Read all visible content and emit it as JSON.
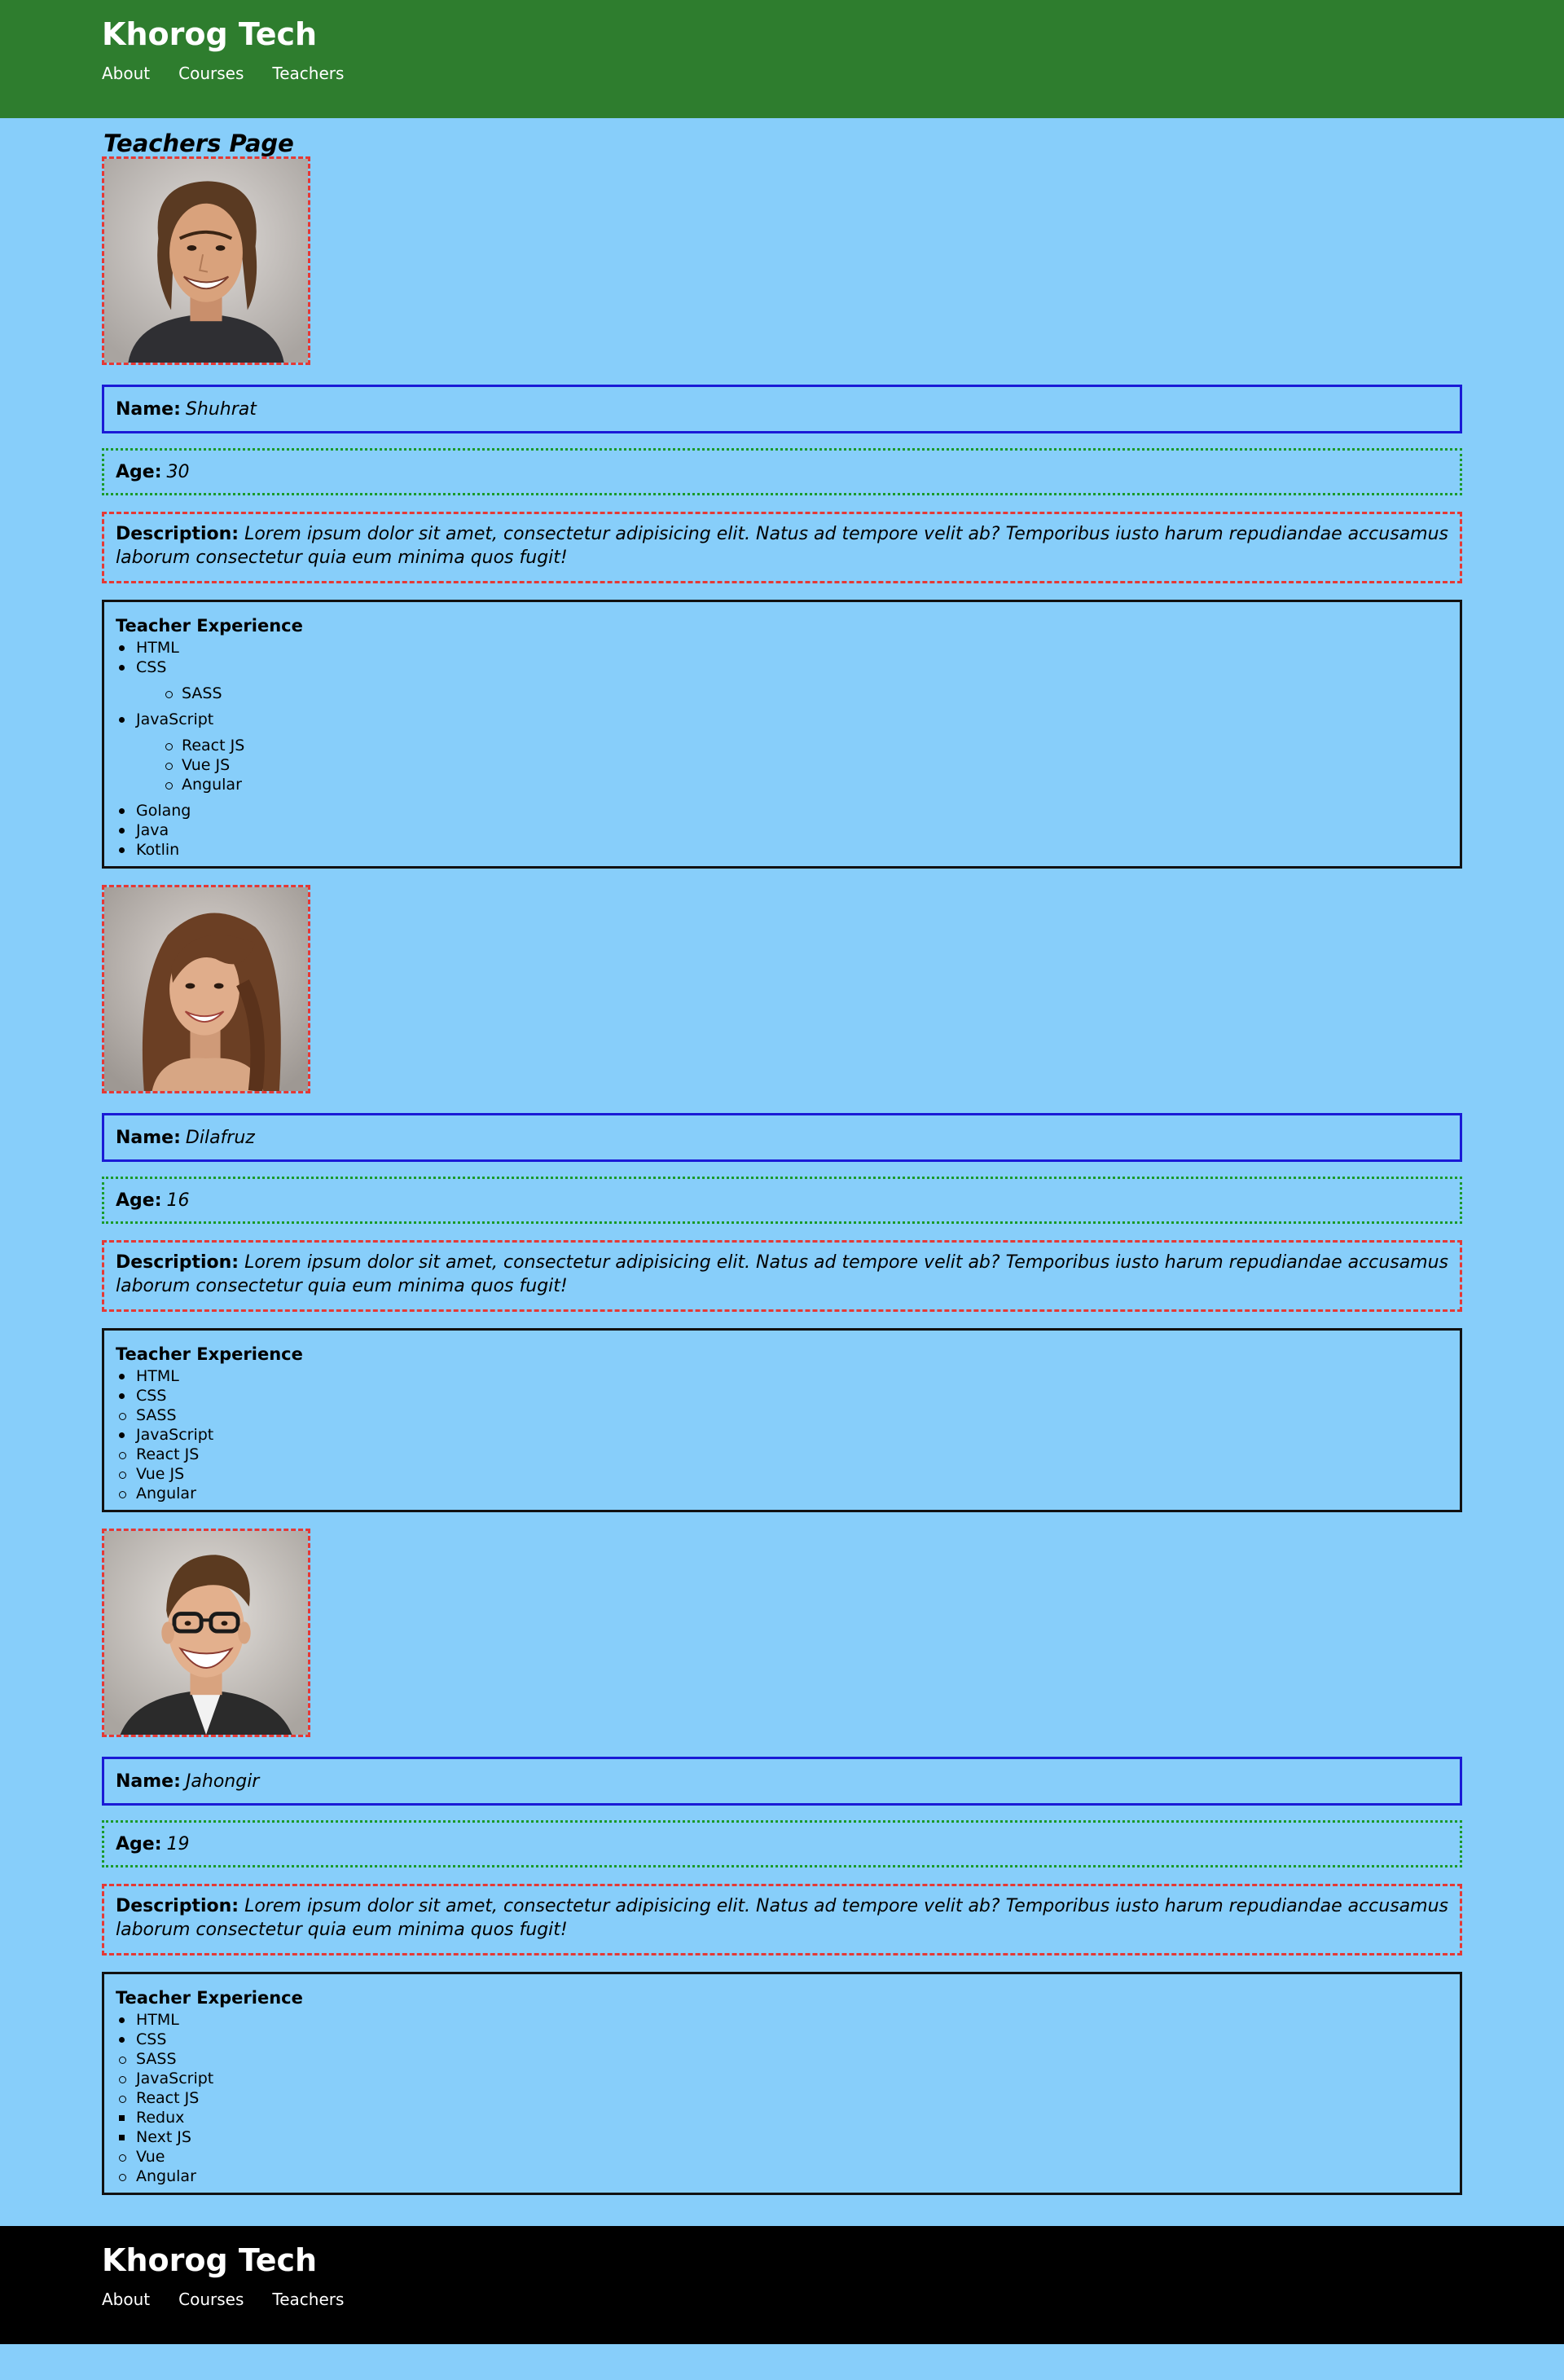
{
  "site": {
    "brand": "Khorog Tech",
    "nav": [
      "About",
      "Courses",
      "Teachers"
    ]
  },
  "page": {
    "title": "Teachers Page"
  },
  "labels": {
    "name": "Name:",
    "age": "Age:",
    "description": "Description:",
    "experience_title": "Teacher Experience"
  },
  "colors": {
    "header_bg": "#2e7d2e",
    "page_bg": "#87cefa",
    "footer_bg": "#000000",
    "name_border": "#1a1ad6",
    "age_border": "#1a9a2a",
    "desc_border": "#e53935"
  },
  "teachers": [
    {
      "name": "Shuhrat",
      "age": "30",
      "photo": "portrait-man-long-hair",
      "description": "Lorem ipsum dolor sit amet, consectetur adipisicing elit. Natus ad tempore velit ab? Temporibus iusto harum repudiandae accusamus laborum consectetur quia eum minima quos fugit!",
      "experience": {
        "html": "HTML",
        "css": "CSS",
        "css_sub": [
          "SASS"
        ],
        "js": "JavaScript",
        "js_sub": [
          "React JS",
          "Vue JS",
          "Angular"
        ],
        "rest": [
          "Golang",
          "Java",
          "Kotlin"
        ]
      }
    },
    {
      "name": "Dilafruz",
      "age": "16",
      "photo": "portrait-woman-brown-hair",
      "description": "Lorem ipsum dolor sit amet, consectetur adipisicing elit. Natus ad tempore velit ab? Temporibus iusto harum repudiandae accusamus laborum consectetur quia eum minima quos fugit!",
      "experience": [
        "HTML",
        "CSS",
        "SASS",
        "JavaScript",
        "React JS",
        "Vue JS",
        "Angular"
      ]
    },
    {
      "name": "Jahongir",
      "age": "19",
      "photo": "portrait-man-glasses",
      "description": "Lorem ipsum dolor sit amet, consectetur adipisicing elit. Natus ad tempore velit ab? Temporibus iusto harum repudiandae accusamus laborum consectetur quia eum minima quos fugit!",
      "experience": [
        "HTML",
        "CSS",
        "SASS",
        "JavaScript",
        "React JS",
        "Redux",
        "Next JS",
        "Vue",
        "Angular"
      ]
    }
  ],
  "footer": {
    "brand": "Khorog Tech",
    "nav": [
      "About",
      "Courses",
      "Teachers"
    ]
  }
}
